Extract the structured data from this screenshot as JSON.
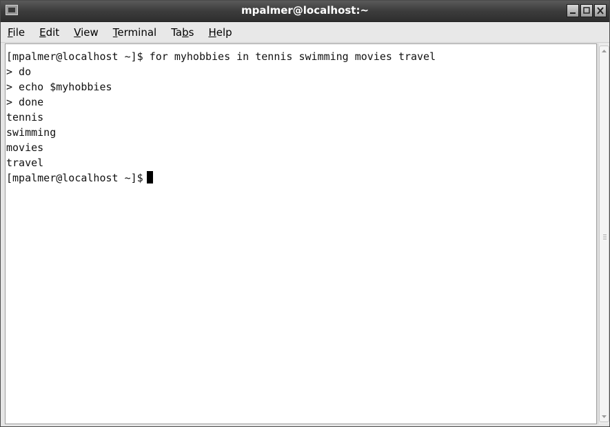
{
  "window": {
    "title": "mpalmer@localhost:~",
    "icons": {
      "app": "terminal-app-icon",
      "minimize": "minimize-icon",
      "maximize": "maximize-icon",
      "close": "close-icon"
    }
  },
  "menubar": {
    "items": [
      {
        "label": "File",
        "mnemonic": "F"
      },
      {
        "label": "Edit",
        "mnemonic": "E"
      },
      {
        "label": "View",
        "mnemonic": "V"
      },
      {
        "label": "Terminal",
        "mnemonic": "T"
      },
      {
        "label": "Tabs",
        "mnemonic": "b"
      },
      {
        "label": "Help",
        "mnemonic": "H"
      }
    ]
  },
  "terminal": {
    "lines": [
      "[mpalmer@localhost ~]$ for myhobbies in tennis swimming movies travel",
      "> do",
      "> echo $myhobbies",
      "> done",
      "tennis",
      "swimming",
      "movies",
      "travel"
    ],
    "prompt": "[mpalmer@localhost ~]$"
  },
  "scrollbar": {
    "icons": {
      "up": "arrow-up-icon",
      "down": "arrow-down-icon",
      "grip": "grip-icon"
    }
  }
}
